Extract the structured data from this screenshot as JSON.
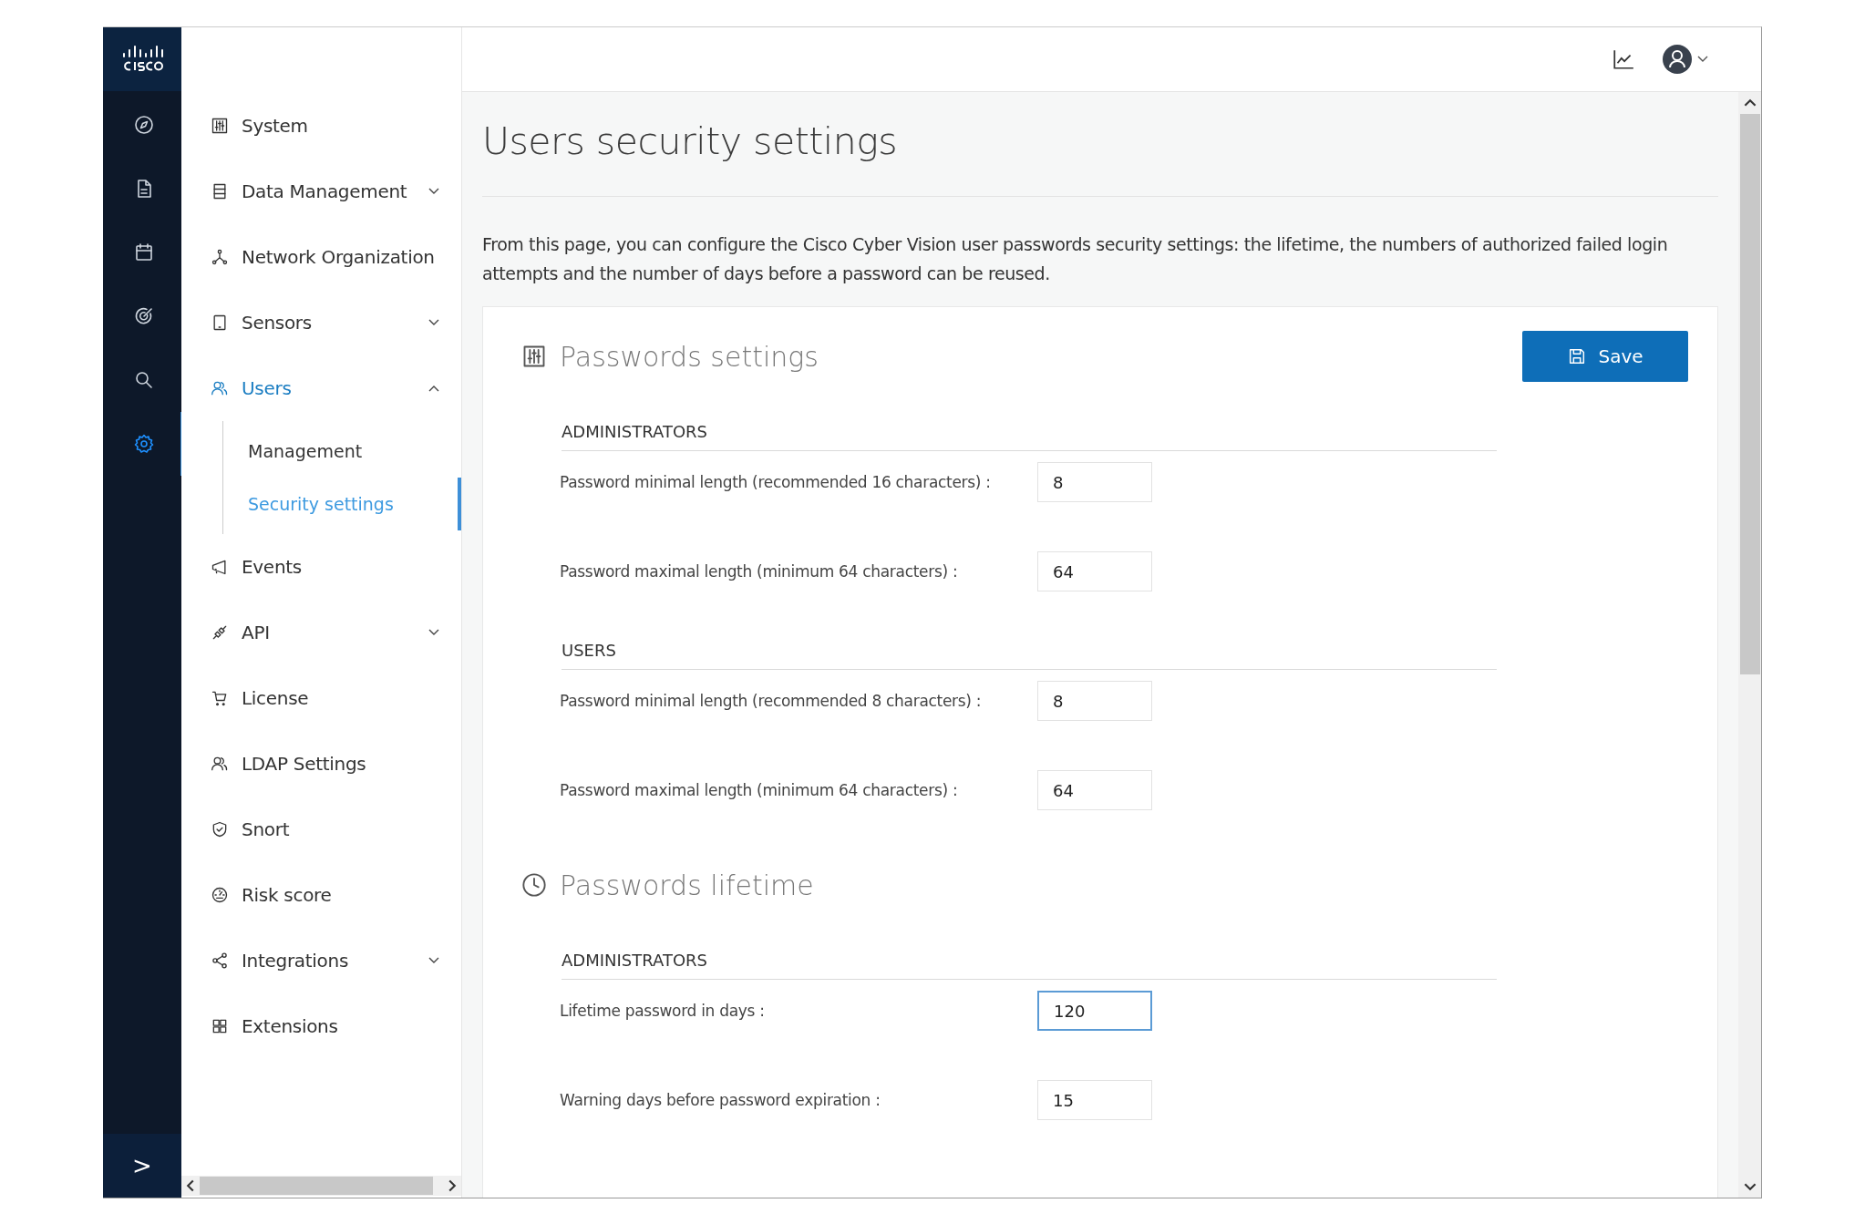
{
  "rail": {
    "items": [
      {
        "selected": false
      },
      {
        "selected": false
      },
      {
        "selected": false
      },
      {
        "selected": false
      },
      {
        "selected": false
      },
      {
        "selected": true
      }
    ],
    "expand_label": ">"
  },
  "sidebar": {
    "items": [
      {
        "label": "System",
        "selected": false
      },
      {
        "label": "Data Management",
        "expanded": false,
        "selected": false
      },
      {
        "label": "Network Organization",
        "selected": false
      },
      {
        "label": "Sensors",
        "expanded": false,
        "selected": false
      },
      {
        "label": "Users",
        "expanded": true,
        "selected": true,
        "children": [
          {
            "label": "Management",
            "selected": false
          },
          {
            "label": "Security settings",
            "selected": true
          }
        ]
      },
      {
        "label": "Events",
        "selected": false
      },
      {
        "label": "API",
        "expanded": false,
        "selected": false
      },
      {
        "label": "License",
        "selected": false
      },
      {
        "label": "LDAP Settings",
        "selected": false
      },
      {
        "label": "Snort",
        "selected": false
      },
      {
        "label": "Risk score",
        "selected": false
      },
      {
        "label": "Integrations",
        "expanded": false,
        "selected": false
      },
      {
        "label": "Extensions",
        "selected": false
      }
    ]
  },
  "page": {
    "title": "Users security settings",
    "description": "From this page, you can configure the Cisco Cyber Vision user passwords security settings: the lifetime, the numbers of authorized failed login attempts and the number of days before a password can be reused.",
    "save_button": "Save",
    "sections": [
      {
        "title": "Passwords settings",
        "groups": [
          {
            "heading": "ADMINISTRATORS",
            "fields": [
              {
                "label": "Password minimal length (recommended 16 characters) :",
                "value": "8",
                "focused": false
              },
              {
                "label": "Password maximal length (minimum 64 characters) :",
                "value": "64",
                "focused": false
              }
            ]
          },
          {
            "heading": "USERS",
            "fields": [
              {
                "label": "Password minimal length (recommended 8 characters) :",
                "value": "8",
                "focused": false
              },
              {
                "label": "Password maximal length (minimum 64 characters) :",
                "value": "64",
                "focused": false
              }
            ]
          }
        ]
      },
      {
        "title": "Passwords lifetime",
        "groups": [
          {
            "heading": "ADMINISTRATORS",
            "fields": [
              {
                "label": "Lifetime password in days :",
                "value": "120",
                "focused": true
              },
              {
                "label": "Warning days before password expiration :",
                "value": "15",
                "focused": false
              }
            ]
          }
        ]
      }
    ]
  }
}
